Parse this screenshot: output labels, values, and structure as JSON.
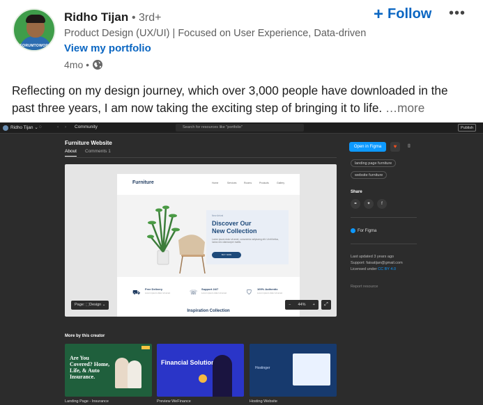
{
  "post": {
    "author_name": "Ridho Tijan",
    "degree": "• 3rd+",
    "headline": "Product Design (UX/UI) | Focused on User Experience, Data-driven",
    "portfolio_link": "View my portfolio",
    "time": "4mo •",
    "follow_label": "Follow",
    "more_menu": "•••",
    "avatar_text": "FORUMTOWORK",
    "body_text": "Reflecting on my design journey, which over 3,000 people have downloaded in the past three years, I am now taking the exciting step of bringing it to life. ",
    "see_more": "…more"
  },
  "figma": {
    "topbar": {
      "user": "Ridho Tijan ⌄",
      "community": "Community",
      "search_placeholder": "Search for resources like \"portfolio\"",
      "publish": "Publish"
    },
    "file_title": "Furniture Website",
    "tabs": {
      "about": "About",
      "comments": "Comments",
      "comments_count": "1"
    },
    "open_button": "Open in Figma",
    "tags": [
      "landing page furniture",
      "website furniture"
    ],
    "share_label": "Share",
    "for_figma": "For Figma",
    "last_updated": "Last updated 3 years ago",
    "support": "Support: faisatijan@gmail.com",
    "licensed": "Licensed under",
    "license_link": "CC BY 4.0",
    "report": "Report resource",
    "preview": {
      "page_pill": "Page: ⬚Design ⌄",
      "zoom_minus": "−",
      "zoom_value": "44%",
      "zoom_plus": "+",
      "site": {
        "logo": "Furniture",
        "nav": [
          "Home",
          "Services",
          "Rooms",
          "Products",
          "Gallery"
        ],
        "kicker": "New Arrival",
        "hero_title_1": "Discover Our",
        "hero_title_2": "New Collection",
        "hero_text": "Lorem ipsum dolor sit amet, consectetur adipiscing elit. Ut elit tellus, luctus nec ullamcorper mattis.",
        "cta": "BUY NOW",
        "features": [
          {
            "title": "Free Delivery",
            "sub": "Lorem ipsum dolor sit amet"
          },
          {
            "title": "Support 24/7",
            "sub": "Lorem ipsum dolor sit amet"
          },
          {
            "title": "100% Authentic",
            "sub": "Lorem ipsum dolor sit amet"
          }
        ],
        "section_title": "Inspiration Collection"
      }
    },
    "more_by": "More by this creator",
    "thumbs": [
      {
        "caption": "Landing Page - Insurance",
        "headline": "Are You Covered? Home, Life, & Auto Insurance."
      },
      {
        "caption": "Preview WeFinance",
        "headline": "Financial Solutions."
      },
      {
        "caption": "Hosting Website",
        "headline": "Hostinger"
      }
    ]
  }
}
